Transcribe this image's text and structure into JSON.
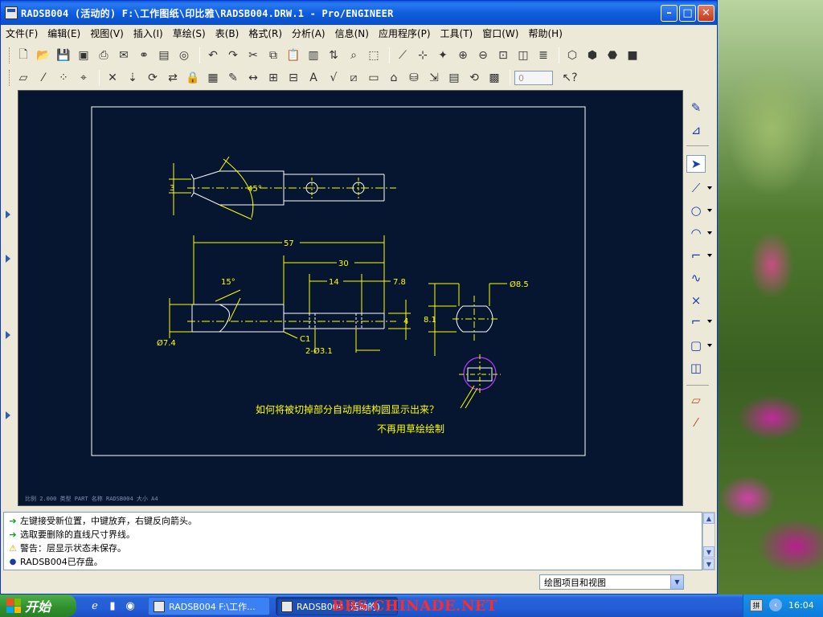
{
  "window": {
    "title": "RADSB004 (活动的) F:\\工作图纸\\印比雅\\RADSB004.DRW.1 - Pro/ENGINEER",
    "min_icon": "minimize-icon",
    "max_icon": "maximize-icon",
    "close_icon": "close-icon"
  },
  "menu": [
    "文件(F)",
    "编辑(E)",
    "视图(V)",
    "插入(I)",
    "草绘(S)",
    "表(B)",
    "格式(R)",
    "分析(A)",
    "信息(N)",
    "应用程序(P)",
    "工具(T)",
    "窗口(W)",
    "帮助(H)"
  ],
  "toolbar": {
    "spin_value": "0",
    "help_icon": "context-help-icon"
  },
  "drawing": {
    "dims": {
      "d3": "3",
      "d45": "45°",
      "d57": "57",
      "d30": "30",
      "d14": "14",
      "d7_8": "7.8",
      "d15": "15°",
      "d8_5": "Ø8.5",
      "d8_1": "8.1",
      "d4": "4",
      "d7_4": "Ø7.4",
      "c1": "C1",
      "holes": "2-Ø3.1"
    },
    "note_line1": "如何将被切掉部分自动用结构圆显示出来？",
    "note_line2": "不再用草绘绘制",
    "status_strip": "比例 2.000   类型 PART   名称 RADSB004   大小 A4",
    "colors": {
      "background": "#061530",
      "geometry": "#ffffff",
      "dimension": "#ffff00",
      "hidden": "#b43cff"
    }
  },
  "messages": [
    {
      "icon": "ok",
      "text": "左键接受新位置，中键放弃，右键反向箭头。"
    },
    {
      "icon": "ok",
      "text": "选取要删除的直线尺寸界线。"
    },
    {
      "icon": "warn",
      "text": "警告：层显示状态未保存。"
    },
    {
      "icon": "dot",
      "text": "RADSB004已存盘。"
    }
  ],
  "filter": {
    "value": "绘图项目和视图"
  },
  "taskbar": {
    "start_label": "开始",
    "task1_label": "RADSB004 F:\\工作...",
    "task2_label": "RADSB004 (活动的)",
    "watermark": "BBS.CHINADE.NET",
    "clock": "16:04"
  }
}
